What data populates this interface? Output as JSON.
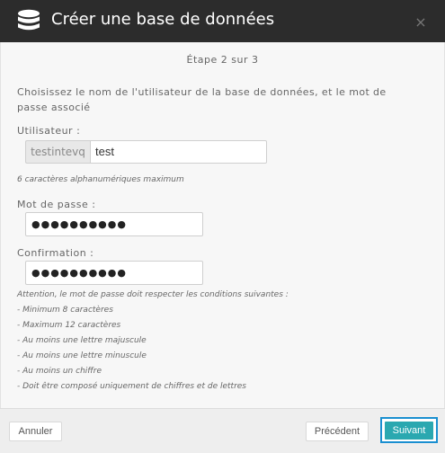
{
  "dialog": {
    "title": "Créer une base de données",
    "icon": "database-icon",
    "close_label": "×"
  },
  "step_text": "Étape 2 sur 3",
  "intro": "Choisissez le nom de l'utilisateur de la base de données, et le mot de passe associé",
  "user": {
    "label": "Utilisateur :",
    "prefix": "testintevq",
    "value": "test",
    "hint": "6 caractères alphanumériques maximum"
  },
  "password": {
    "label": "Mot de passe :",
    "masked": "●●●●●●●●●●"
  },
  "confirmation": {
    "label": "Confirmation :",
    "masked": "●●●●●●●●●●"
  },
  "rules": [
    "Attention, le mot de passe doit respecter les conditions suivantes :",
    "- Minimum 8 caractères",
    "- Maximum 12 caractères",
    "- Au moins une lettre majuscule",
    "- Au moins une lettre minuscule",
    "- Au moins un chiffre",
    "- Doit être composé uniquement de chiffres et de lettres"
  ],
  "footer": {
    "cancel": "Annuler",
    "previous": "Précédent",
    "next": "Suivant"
  },
  "colors": {
    "titlebar": "#2c2c2c",
    "accent": "#2aa8b0",
    "focus_ring": "#1a8fd0"
  }
}
